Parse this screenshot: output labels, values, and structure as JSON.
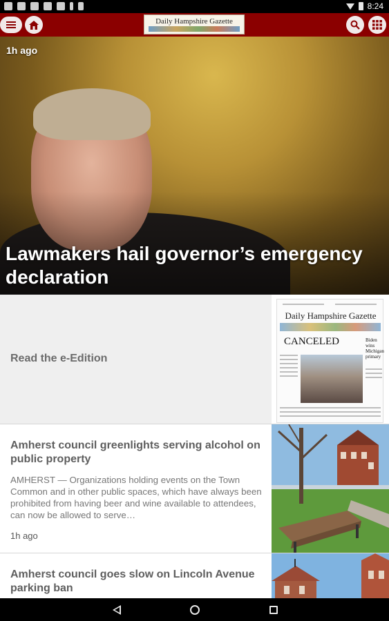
{
  "status_bar": {
    "time": "8:24",
    "icons": [
      "gallery-icon",
      "image-icon",
      "photo-icon",
      "news-icon",
      "news-icon",
      "battery-saver-icon",
      "check-icon"
    ]
  },
  "app_bar": {
    "logo_text": "Daily Hampshire Gazette",
    "accent_color": "#8b0000"
  },
  "hero": {
    "time": "1h ago",
    "title": "Lawmakers hail governor’s emergency declaration"
  },
  "eedition": {
    "label": "Read the e-Edition",
    "paper_masthead": "Daily Hampshire Gazette",
    "paper_headline": "CANCELED",
    "paper_side_headline": "Biden wins Michigan primary"
  },
  "articles": [
    {
      "title": "Amherst council greenlights serving alcohol on public property",
      "summary": "AMHERST — Organizations holding events on the Town Common and in other public spaces, which have always been prohibited from having beer and wine available to attendees, can now be allowed to serve…",
      "time": "1h ago"
    },
    {
      "title": "Amherst council goes slow on Lincoln Avenue parking ban",
      "summary": "",
      "time": ""
    }
  ]
}
